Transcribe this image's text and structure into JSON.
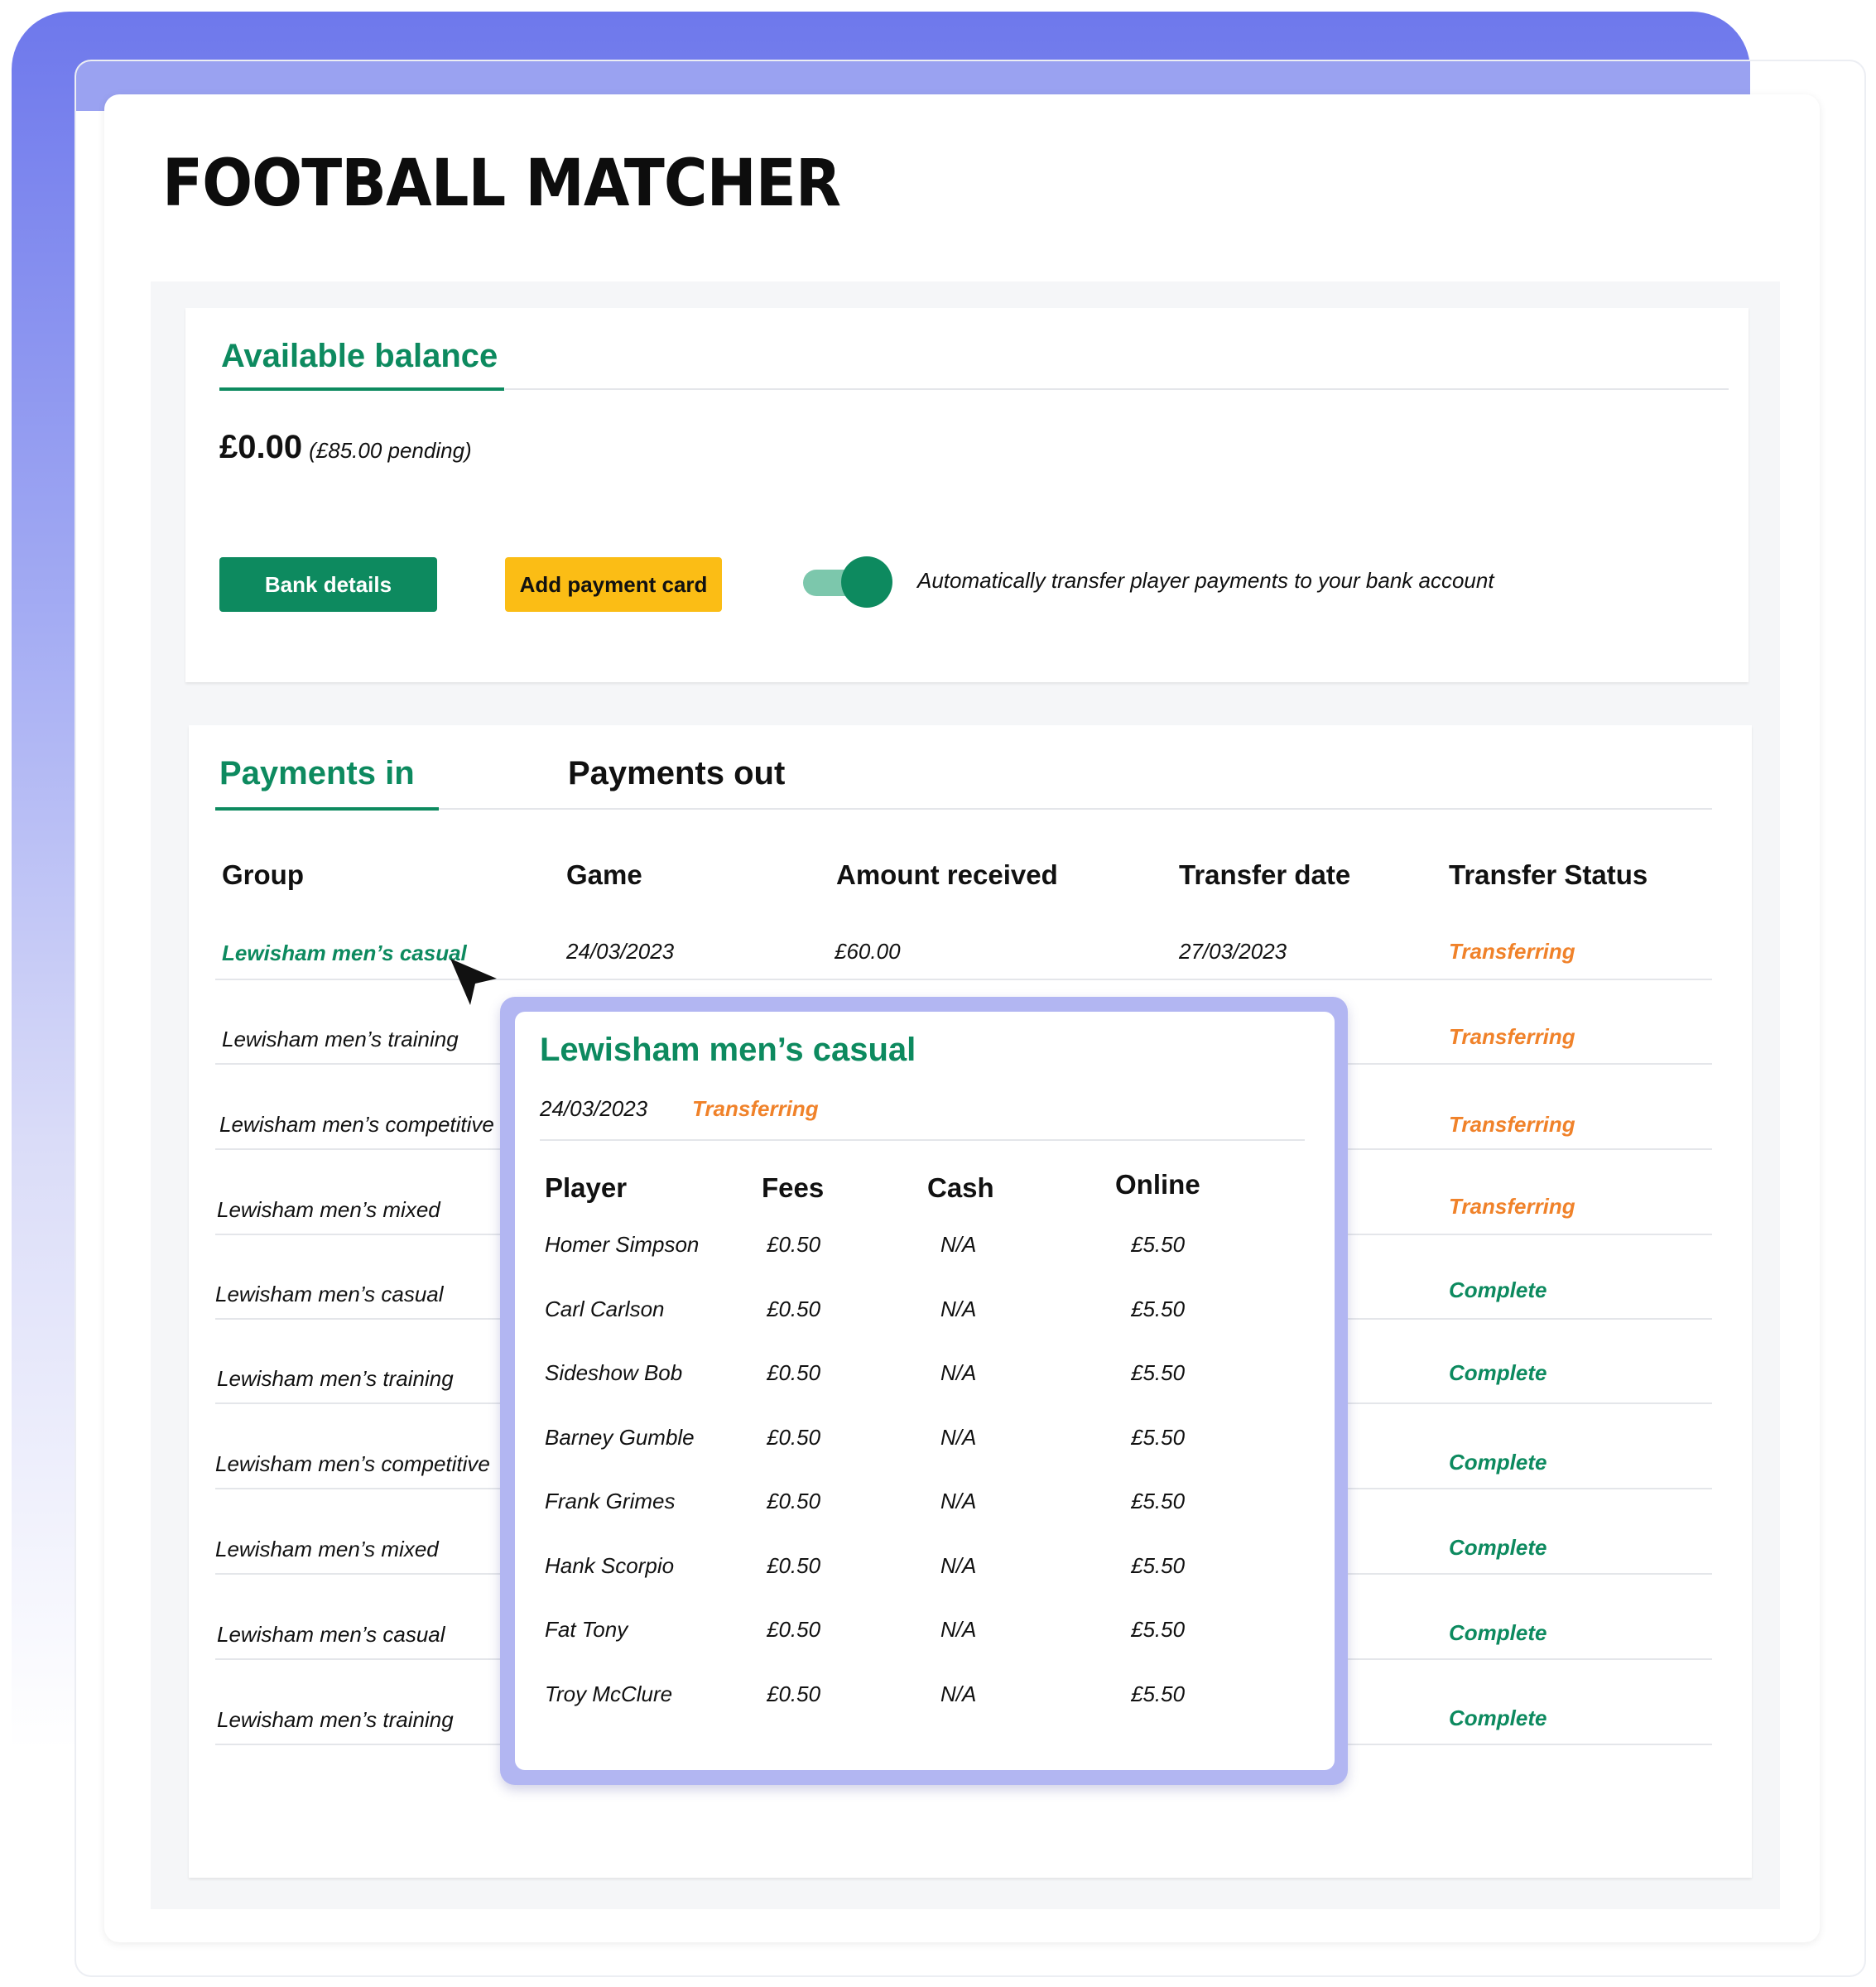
{
  "logo": {
    "text": "FOOTBALL MATCHER"
  },
  "balance": {
    "tab_label": "Available balance",
    "amount": "£0.00",
    "pending": "(£85.00 pending)",
    "bank_button": "Bank details",
    "card_button": "Add payment card",
    "toggle_label": "Automatically transfer player payments to your bank account",
    "toggle_on": true
  },
  "payments": {
    "tabs": [
      {
        "label": "Payments in"
      },
      {
        "label": "Payments out"
      }
    ],
    "columns": [
      "Group",
      "Game",
      "Amount received",
      "Transfer date",
      "Transfer Status"
    ],
    "rows": [
      {
        "group": "Lewisham men’s casual",
        "game": "24/03/2023",
        "amount": "£60.00",
        "transfer_date": "27/03/2023",
        "status": "Transferring"
      },
      {
        "group": "Lewisham men’s training",
        "status": "Transferring"
      },
      {
        "group": "Lewisham men’s competitive",
        "status": "Transferring"
      },
      {
        "group": "Lewisham men’s mixed",
        "status": "Transferring"
      },
      {
        "group": "Lewisham men’s casual",
        "status": "Complete"
      },
      {
        "group": "Lewisham men’s training",
        "status": "Complete"
      },
      {
        "group": "Lewisham men’s competitive",
        "status": "Complete"
      },
      {
        "group": "Lewisham men’s mixed",
        "status": "Complete"
      },
      {
        "group": "Lewisham men’s casual",
        "status": "Complete"
      },
      {
        "group": "Lewisham men’s training",
        "status": "Complete"
      }
    ]
  },
  "popup": {
    "title": "Lewisham men’s casual",
    "date": "24/03/2023",
    "status": "Transferring",
    "columns": [
      "Player",
      "Fees",
      "Cash",
      "Online"
    ],
    "rows": [
      {
        "player": "Homer Simpson",
        "fees": "£0.50",
        "cash": "N/A",
        "online": "£5.50"
      },
      {
        "player": "Carl Carlson",
        "fees": "£0.50",
        "cash": "N/A",
        "online": "£5.50"
      },
      {
        "player": "Sideshow Bob",
        "fees": "£0.50",
        "cash": "N/A",
        "online": "£5.50"
      },
      {
        "player": "Barney Gumble",
        "fees": "£0.50",
        "cash": "N/A",
        "online": "£5.50"
      },
      {
        "player": "Frank Grimes",
        "fees": "£0.50",
        "cash": "N/A",
        "online": "£5.50"
      },
      {
        "player": "Hank Scorpio",
        "fees": "£0.50",
        "cash": "N/A",
        "online": "£5.50"
      },
      {
        "player": "Fat Tony",
        "fees": "£0.50",
        "cash": "N/A",
        "online": "£5.50"
      },
      {
        "player": "Troy McClure",
        "fees": "£0.50",
        "cash": "N/A",
        "online": "£5.50"
      }
    ]
  },
  "colors": {
    "brand_green": "#0d8a5f",
    "accent_yellow": "#fbbd15",
    "status_orange": "#f0822a",
    "popup_border": "#b2b6f2"
  },
  "icons": {
    "cursor": "mouse-pointer-icon"
  }
}
